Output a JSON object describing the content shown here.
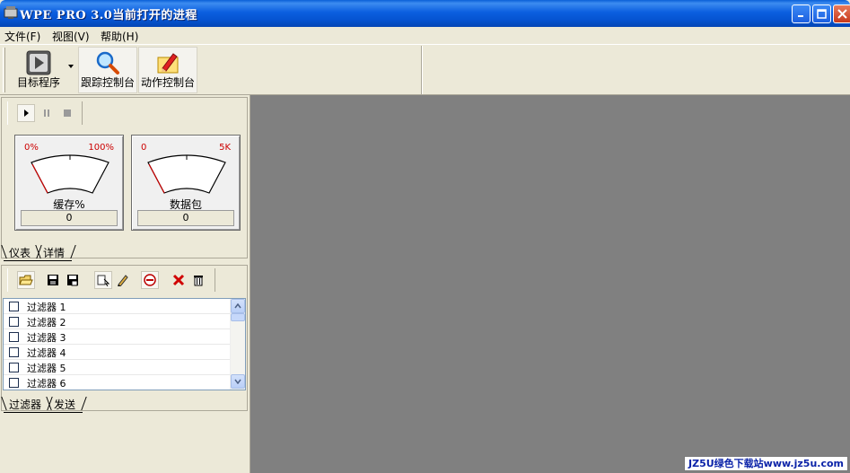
{
  "window": {
    "title": "WPE PRO 3.0当前打开的进程",
    "minimize": "minimize",
    "maximize": "maximize",
    "close": "close"
  },
  "menu": [
    "文件(F)",
    "视图(V)",
    "帮助(H)"
  ],
  "toolbar": {
    "target_label": "目标程序",
    "trace_label": "跟踪控制台",
    "action_label": "动作控制台"
  },
  "capture_controls": [
    "play-icon",
    "pause-icon",
    "stop-icon"
  ],
  "gauges": [
    {
      "min": "0%",
      "max": "100%",
      "label": "缓存%",
      "value": "0",
      "level": 0
    },
    {
      "min": "0",
      "max": "5K",
      "label": "数据包",
      "value": "0",
      "level": 0
    }
  ],
  "gauge_tabs": [
    "仪表",
    "详情"
  ],
  "filter_toolbar": [
    "open-folder-icon",
    "save-icon",
    "save-as-icon",
    "edit-pointer-icon",
    "pencil-icon",
    "onoff-icon",
    "delete-icon",
    "trash-icon"
  ],
  "filters": [
    {
      "label": "过滤器 1",
      "checked": false
    },
    {
      "label": "过滤器 2",
      "checked": false
    },
    {
      "label": "过滤器 3",
      "checked": false
    },
    {
      "label": "过滤器 4",
      "checked": false
    },
    {
      "label": "过滤器 5",
      "checked": false
    },
    {
      "label": "过滤器 6",
      "checked": false
    }
  ],
  "filter_tabs": [
    "过滤器",
    "发送"
  ],
  "watermark": "JZ5U绿色下载站www.jz5u.com",
  "colors": {
    "titlebar": "#0553d0",
    "workspace": "#808080",
    "gauge_red": "#cc0000"
  }
}
